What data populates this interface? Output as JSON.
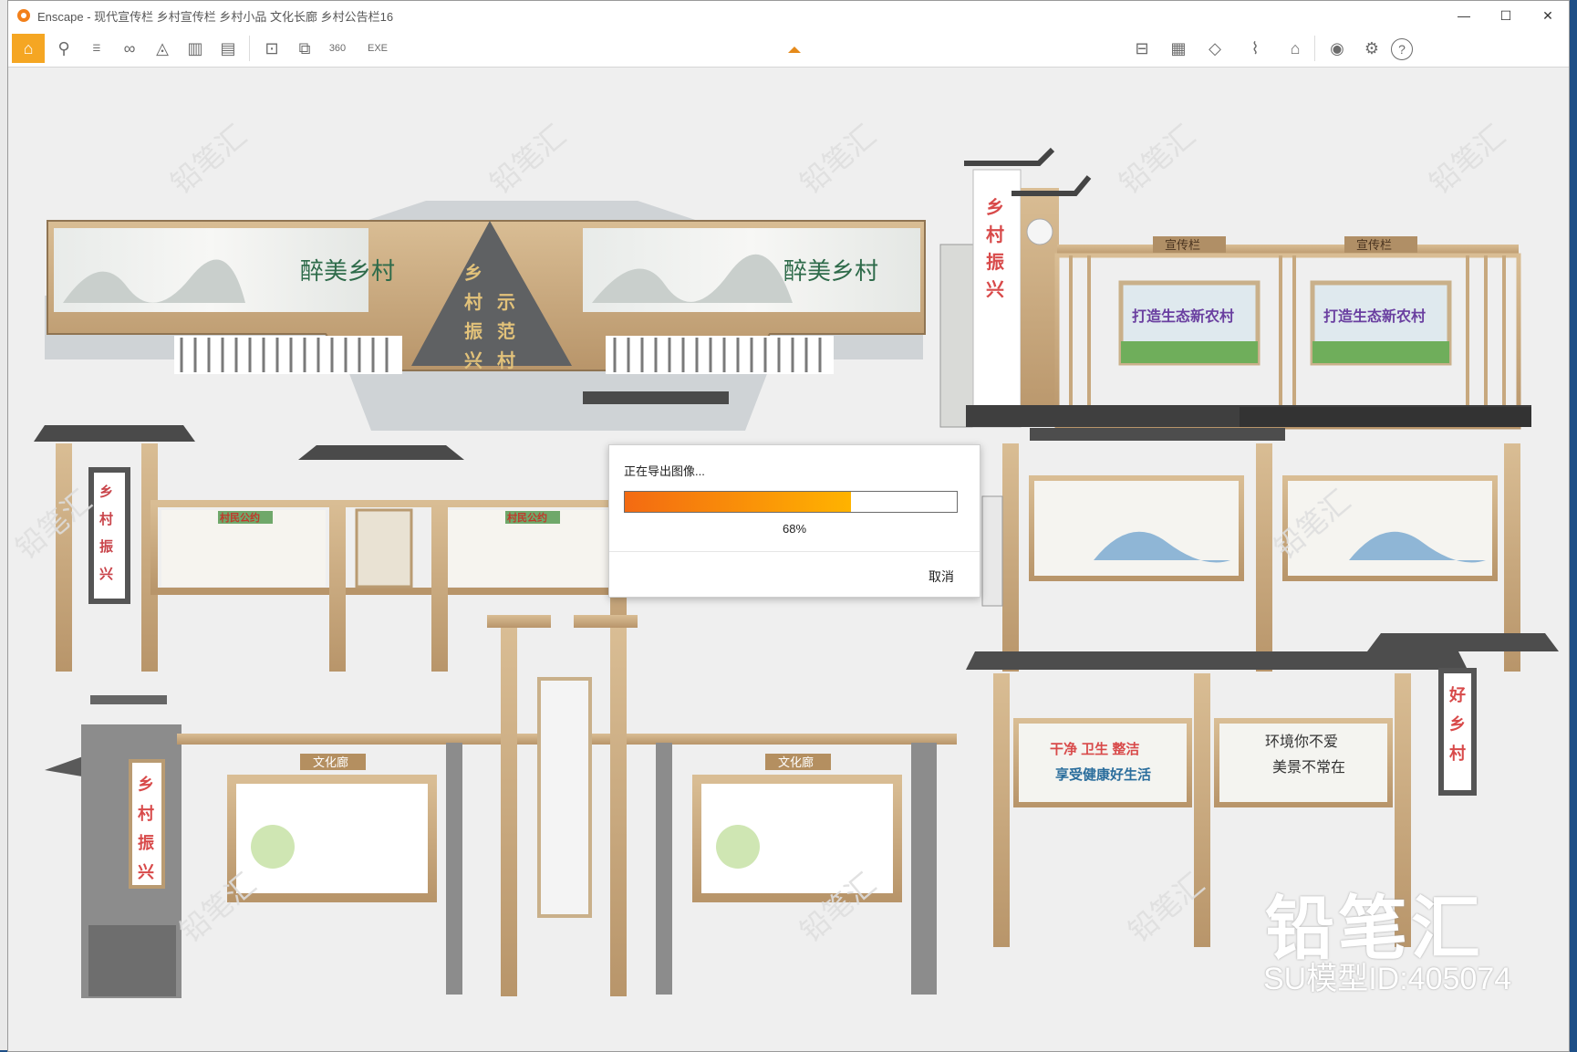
{
  "window": {
    "title": "Enscape - 现代宣传栏 乡村宣传栏 乡村小品 文化长廊 乡村公告栏16"
  },
  "toolbar": {
    "items": [
      {
        "name": "home-icon",
        "glyph": "⌂"
      },
      {
        "name": "link-icon",
        "glyph": "⚲"
      },
      {
        "name": "bim-icon",
        "glyph": "BIM"
      },
      {
        "name": "binoculars-icon",
        "glyph": "∞"
      },
      {
        "name": "assets-icon",
        "glyph": "◬"
      },
      {
        "name": "buildings-icon",
        "glyph": "▥"
      },
      {
        "name": "video-icon",
        "glyph": "▤"
      },
      {
        "name": "screenshot-icon",
        "glyph": "⊡"
      },
      {
        "name": "batch-render-icon",
        "glyph": "⧉"
      },
      {
        "name": "panorama-icon",
        "glyph": "360°"
      },
      {
        "name": "export-exe-icon",
        "glyph": "EXE"
      }
    ],
    "right_items": [
      {
        "name": "views-icon",
        "glyph": "⊟"
      },
      {
        "name": "library-icon",
        "glyph": "▦"
      },
      {
        "name": "cube-icon",
        "glyph": "◇"
      },
      {
        "name": "chart-icon",
        "glyph": "⌇"
      },
      {
        "name": "hat-icon",
        "glyph": "⌂"
      },
      {
        "name": "eye-icon",
        "glyph": "◉"
      },
      {
        "name": "settings-icon",
        "glyph": "⚙"
      },
      {
        "name": "help-icon",
        "glyph": "?"
      }
    ]
  },
  "scene": {
    "billboard1": {
      "center_text": [
        "乡",
        "村",
        "振",
        "兴",
        "示",
        "范",
        "村"
      ],
      "panel_text": "醉美乡村"
    },
    "billboard2": {
      "sign": "宣传栏",
      "vertical": "乡村振兴",
      "panel_text": "打造生态新农村"
    },
    "row2_left": {
      "sign": "村民公约",
      "vertical": "乡村振兴"
    },
    "row3_left": {
      "sign": "文化廊",
      "vertical": "乡村振兴"
    },
    "row3_right": {
      "panel_left": "干净 卫生 整洁 享受健康好生活",
      "panel_right": "环境你不爱 美景不常在",
      "vertical": "好乡村"
    }
  },
  "dialog": {
    "title": "正在导出图像...",
    "progress_label": "68%",
    "progress": 0.68,
    "cancel_label": "取消"
  },
  "watermark": {
    "brand": "铅笔汇",
    "model_id": "SU模型ID:405074"
  }
}
